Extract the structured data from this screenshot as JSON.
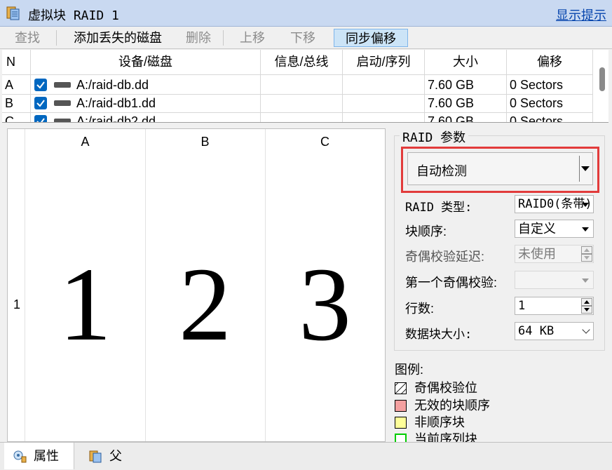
{
  "window": {
    "title": "虚拟块 RAID 1",
    "hint_link": "显示提示"
  },
  "toolbar": {
    "find": "查找",
    "add_missing": "添加丢失的磁盘",
    "delete": "删除",
    "move_up": "上移",
    "move_down": "下移",
    "sync_offset": "同步偏移"
  },
  "disk_table": {
    "columns": {
      "n": "N",
      "device": "设备/磁盘",
      "info": "信息/总线",
      "boot": "启动/序列",
      "size": "大小",
      "offset": "偏移"
    },
    "rows": [
      {
        "n": "A",
        "device": "A:/raid-db.dd",
        "size": "7.60 GB",
        "offset": "0 Sectors",
        "checked": true
      },
      {
        "n": "B",
        "device": "A:/raid-db1.dd",
        "size": "7.60 GB",
        "offset": "0 Sectors",
        "checked": true
      },
      {
        "n": "C",
        "device": "A:/raid-db2.dd",
        "size": "7.60 GB",
        "offset": "0 Sectors",
        "checked": true
      }
    ]
  },
  "grid": {
    "columns": [
      "A",
      "B",
      "C"
    ],
    "row_label": "1",
    "cells": [
      "1",
      "2",
      "3"
    ]
  },
  "params": {
    "group_title": "RAID 参数",
    "auto_detect": "自动检测",
    "raid_type_label": "RAID 类型:",
    "raid_type_value": "RAID0(条带)",
    "block_order_label": "块顺序:",
    "block_order_value": "自定义",
    "parity_delay_label": "奇偶校验延迟:",
    "parity_delay_value": "未使用",
    "first_parity_label": "第一个奇偶校验:",
    "first_parity_value": "",
    "rows_label": "行数:",
    "rows_value": "1",
    "block_size_label": "数据块大小:",
    "block_size_value": "64 KB"
  },
  "legend": {
    "title": "图例:",
    "items": [
      {
        "label": "奇偶校验位",
        "color": "#ffffff"
      },
      {
        "label": "无效的块顺序",
        "color": "#f4a0a0"
      },
      {
        "label": "非顺序块",
        "color": "#ffff99"
      },
      {
        "label": "当前序列块",
        "color": "#00cc00"
      }
    ]
  },
  "bottom_tabs": {
    "properties": "属性",
    "parent": "父"
  },
  "colors": {
    "accent": "#0067c0",
    "highlight_border": "#e23b3b",
    "titlebar": "#c9d9f1",
    "link": "#0645ad"
  }
}
